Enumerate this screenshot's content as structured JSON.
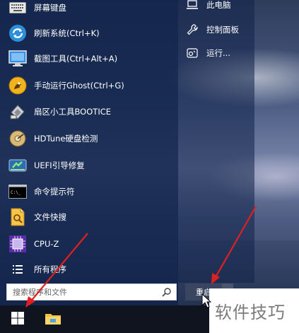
{
  "apps": [
    {
      "name": "keyboard-icon",
      "label": "屏幕键盘"
    },
    {
      "name": "refresh-system-icon",
      "label": "刷新系统(Ctrl+K)"
    },
    {
      "name": "screenshot-tool-icon",
      "label": "截图工具(Ctrl+Alt+A)"
    },
    {
      "name": "ghost-icon",
      "label": "手动运行Ghost(Ctrl+G)"
    },
    {
      "name": "bootice-icon",
      "label": "扇区小工具BOOTICE"
    },
    {
      "name": "hdtune-icon",
      "label": "HDTune硬盘检测"
    },
    {
      "name": "uefi-repair-icon",
      "label": "UEFI引导修复"
    },
    {
      "name": "cmd-icon",
      "label": "命令提示符"
    },
    {
      "name": "file-quickview-icon",
      "label": "文件快搜"
    },
    {
      "name": "cpu-z-icon",
      "label": "CPU-Z"
    },
    {
      "name": "all-programs-icon",
      "label": "所有程序"
    }
  ],
  "right_items": [
    {
      "name": "computer-icon",
      "label": "此电脑"
    },
    {
      "name": "wrench-icon",
      "label": "控制面板"
    },
    {
      "name": "run-icon",
      "label": "运行..."
    }
  ],
  "search": {
    "placeholder": "搜索程序和文件"
  },
  "power": {
    "restart_label": "重启"
  },
  "watermark": {
    "text": "软件技巧"
  },
  "colors": {
    "menu_bg": "#10224a",
    "taskbar": "#10141e",
    "accent_red": "#e02020"
  }
}
